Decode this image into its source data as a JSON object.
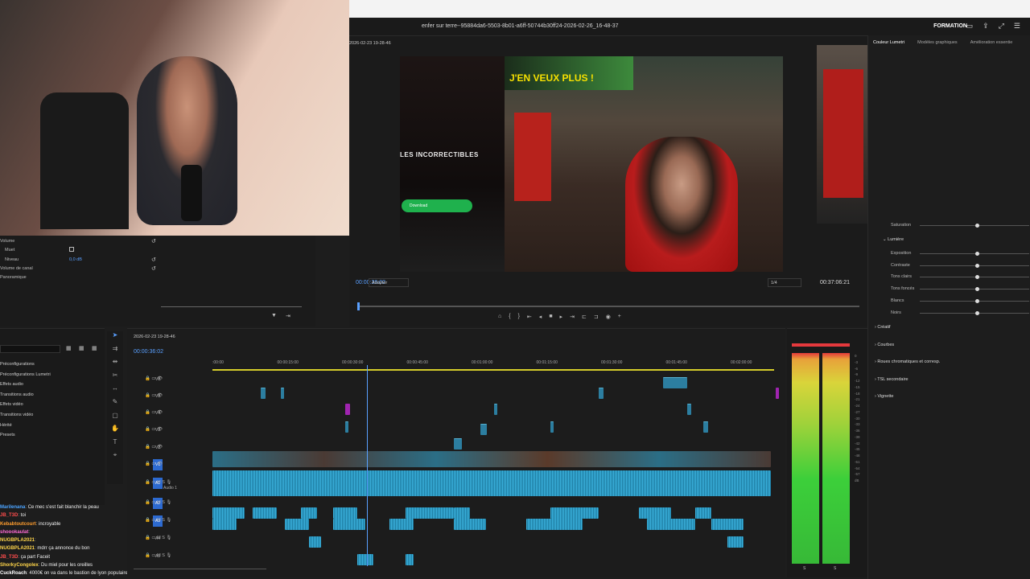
{
  "app": {
    "sequence_title": "enfer sur terre--95884da6-5503-8b01-a6ff-50744b30ff24-2026-02-26_16-48-37",
    "workspace": "FORMATION"
  },
  "program_monitor": {
    "sequence_tab": "2026-02-23 19-28-46",
    "timecode_current": "00:00:36:02",
    "timecode_duration": "00:37:06:21",
    "fit": "Adapter",
    "resolution": "1/4",
    "overlay_title": "J'EN VEUX PLUS !",
    "side_title": "LES INCORRECTIBLES",
    "download_label": "Download"
  },
  "effect_controls": {
    "volume": "Volume",
    "mute": "Muet",
    "level": "Niveau",
    "level_value": "0,0 dB",
    "channel_volume": "Volume de canal",
    "panner": "Panoramique"
  },
  "project": {
    "items": [
      "Préconfigurations",
      "Préconfigurations Lumetri",
      "Effets audio",
      "Transitions audio",
      "Effets vidéo",
      "Transitions vidéo",
      "Hérité",
      "Presets"
    ]
  },
  "timeline": {
    "tab": "2026-02-23 19-28-46",
    "timecode": "00:00:36:02",
    "ruler": [
      ":00:00",
      "00:00:15:00",
      "00:00:30:00",
      "00:00:45:00",
      "00:01:00:00",
      "00:01:15:00",
      "00:01:30:00",
      "00:01:45:00",
      "00:02:00:00"
    ],
    "video_tracks": [
      "V6",
      "V5",
      "V4",
      "V3",
      "V2",
      "V1"
    ],
    "audio_tracks": [
      "A1",
      "A2",
      "A3",
      "A4",
      "A5"
    ],
    "audio1_name": "Audio 1"
  },
  "meters": {
    "scale": [
      "0",
      "-3",
      "-6",
      "-9",
      "-12",
      "-15",
      "-18",
      "-21",
      "-24",
      "-27",
      "-30",
      "-33",
      "-36",
      "-39",
      "-42",
      "-45",
      "-48",
      "-51",
      "-54",
      "-57",
      "dB"
    ],
    "solo_l": "S",
    "solo_r": "S"
  },
  "lumetri": {
    "tabs": [
      "Couleur Lumetri",
      "Modèles graphiques",
      "Amélioration essentie"
    ],
    "saturation": "Saturation",
    "light_section": "Lumière",
    "light_rows": [
      "Exposition",
      "Contraste",
      "Tons clairs",
      "Tons foncés",
      "Blancs",
      "Noirs"
    ],
    "sections": [
      "Créatif",
      "Courbes",
      "Roues chromatiques et corresp.",
      "TSL secondaire",
      "Vignette"
    ]
  },
  "chat": [
    {
      "user": "Marilenana",
      "msg": "Ce mec s'est fait blanchir la peau",
      "color": "#4aa3ff"
    },
    {
      "user": "JB_T3D",
      "msg": "toi",
      "color": "#ff4d4d"
    },
    {
      "user": "Kebabtoutcourt",
      "msg": "incroyable",
      "color": "#ff9d2e"
    },
    {
      "user": "shoookaulat",
      "msg": "",
      "color": "#ff6bd6"
    },
    {
      "user": "NUGBPLA2021",
      "msg": "",
      "color": "#ffd54a"
    },
    {
      "user": "NUGBPLA2021",
      "msg": "mdrr ça annonce du bon",
      "color": "#ffd54a"
    },
    {
      "user": "JB_T3D",
      "msg": "ça part Faceit",
      "color": "#ff4d4d"
    },
    {
      "user": "ShorkyCongolex",
      "msg": "Du miel pour les oreilles",
      "color": "#ffd54a"
    },
    {
      "user": "CuckRoach",
      "msg": "4000€ on va dans le bastion de lyon populaire",
      "color": "#ffffff"
    }
  ]
}
